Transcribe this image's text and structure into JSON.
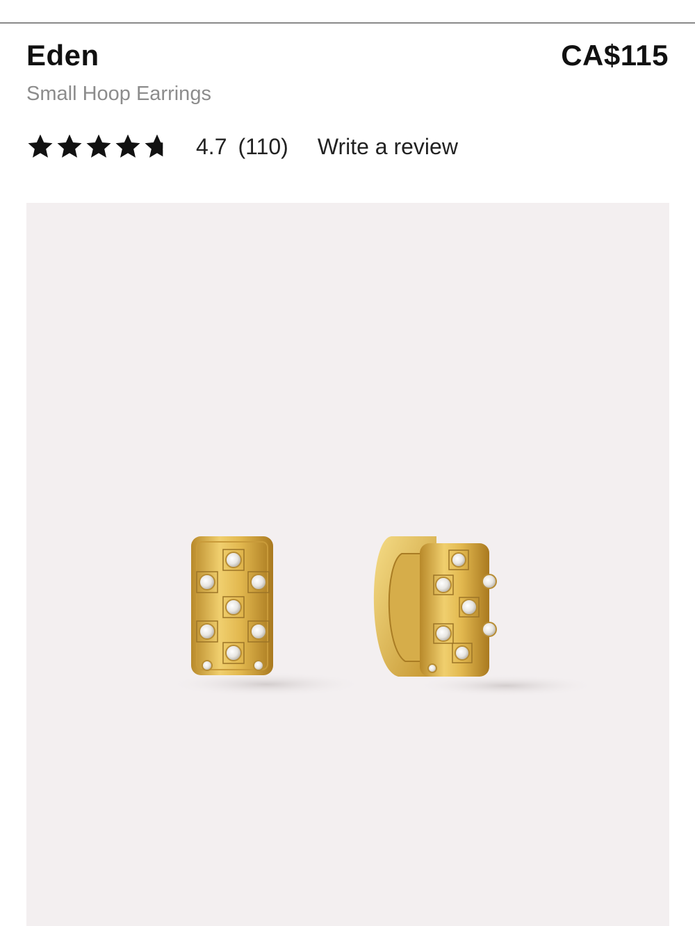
{
  "product": {
    "name": "Eden",
    "subtitle": "Small Hoop Earrings",
    "price": "CA$115"
  },
  "rating": {
    "value": "4.7",
    "count": "(110)",
    "stars_filled": 4.7,
    "stars_total": 5,
    "write_review_label": "Write a review"
  },
  "image": {
    "alt": "Gold checkerboard huggie hoop earrings with crystals",
    "icon": "product-photo"
  },
  "colors": {
    "text": "#111111",
    "muted": "#8c8c8c",
    "image_background": "#f3eff0",
    "gold": "#d9b24a",
    "divider": "#8a8a8a"
  }
}
